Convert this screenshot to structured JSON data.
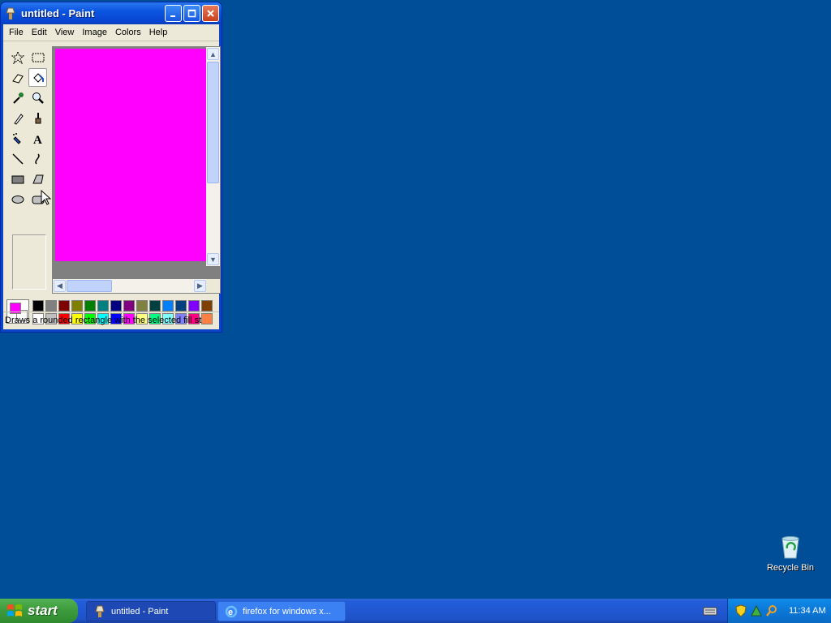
{
  "window": {
    "title": "untitled - Paint",
    "menu": [
      "File",
      "Edit",
      "View",
      "Image",
      "Colors",
      "Help"
    ],
    "status": "Draws a rounded rectangle with the selected fill st",
    "canvas_color": "#ff00ff"
  },
  "tools": [
    "free-form-select",
    "select",
    "eraser",
    "fill-with-color",
    "pick-color",
    "magnifier",
    "pencil",
    "brush",
    "airbrush",
    "text",
    "line",
    "curve",
    "rectangle",
    "polygon",
    "ellipse",
    "rounded-rectangle"
  ],
  "selected_tool": "fill-with-color",
  "palette": {
    "foreground": "#ff00ff",
    "background": "#ffffff",
    "row1": [
      "#000000",
      "#808080",
      "#800000",
      "#808000",
      "#008000",
      "#008080",
      "#000080",
      "#800080",
      "#808040",
      "#004040",
      "#0080ff",
      "#004080",
      "#8000ff",
      "#804000"
    ],
    "row2": [
      "#ffffff",
      "#c0c0c0",
      "#ff0000",
      "#ffff00",
      "#00ff00",
      "#00ffff",
      "#0000ff",
      "#ff00ff",
      "#ffff80",
      "#00ff80",
      "#80ffff",
      "#8080ff",
      "#ff0080",
      "#ff8040"
    ]
  },
  "desktop": {
    "recycle_bin": "Recycle Bin"
  },
  "taskbar": {
    "start": "start",
    "tasks": [
      "untitled - Paint",
      "firefox for windows x..."
    ],
    "clock": "11:34 AM"
  }
}
